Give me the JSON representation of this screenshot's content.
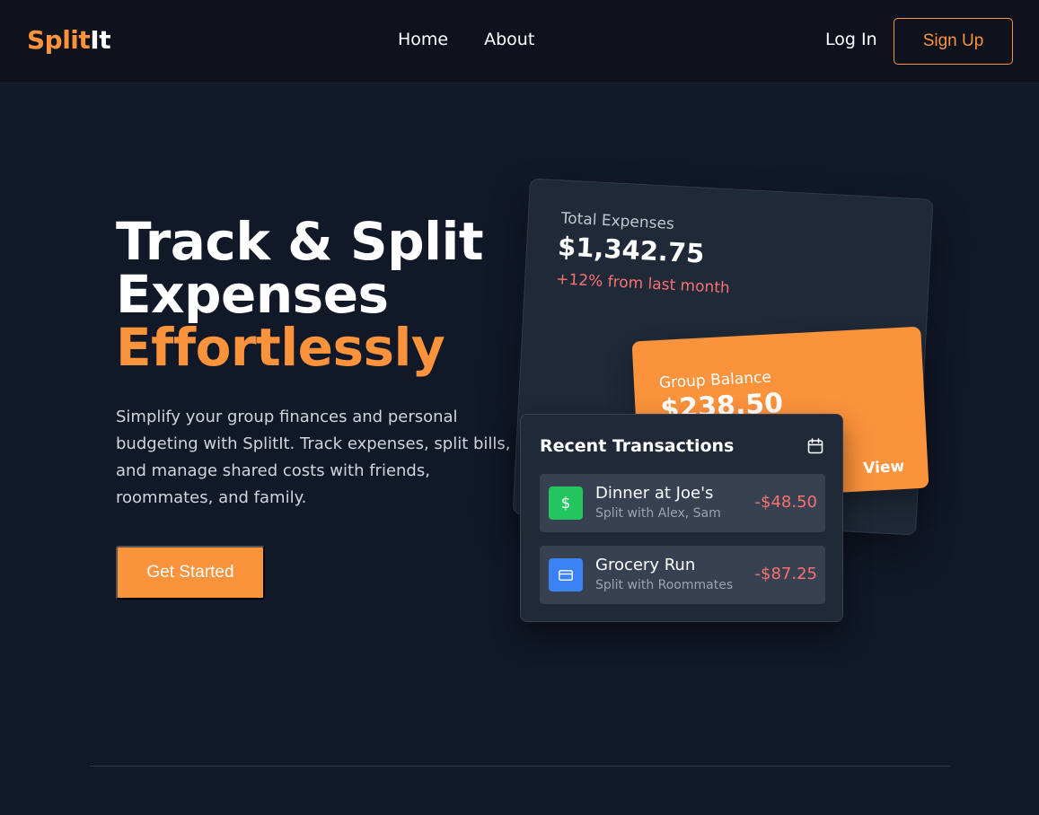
{
  "nav": {
    "logo_part1": "Split",
    "logo_part2": "It",
    "links": [
      "Home",
      "About"
    ],
    "login": "Log In",
    "signup": "Sign Up"
  },
  "hero": {
    "title_line1": "Track & Split",
    "title_line2": "Expenses",
    "title_highlight": "Effortlessly",
    "description": "Simplify your group finances and personal budgeting with SplitIt. Track expenses, split bills, and manage shared costs with friends, roommates, and family.",
    "cta": "Get Started"
  },
  "total_card": {
    "label": "Total Expenses",
    "value": "$1,342.75",
    "change": "+12% from last month"
  },
  "group_card": {
    "label": "Group Balance",
    "value": "$238.50",
    "view": "View"
  },
  "transactions": {
    "title": "Recent Transactions",
    "icon": "calendar-icon",
    "items": [
      {
        "name": "Dinner at Joe's",
        "sub": "Split with Alex, Sam",
        "amount": "-$48.50",
        "icon": "dollar-icon",
        "icon_color": "#22c55e"
      },
      {
        "name": "Grocery Run",
        "sub": "Split with Roommates",
        "amount": "-$87.25",
        "icon": "credit-card-icon",
        "icon_color": "#3b82f6"
      }
    ]
  },
  "colors": {
    "accent": "#fb923c",
    "background": "#111827",
    "negative": "#f87171"
  }
}
